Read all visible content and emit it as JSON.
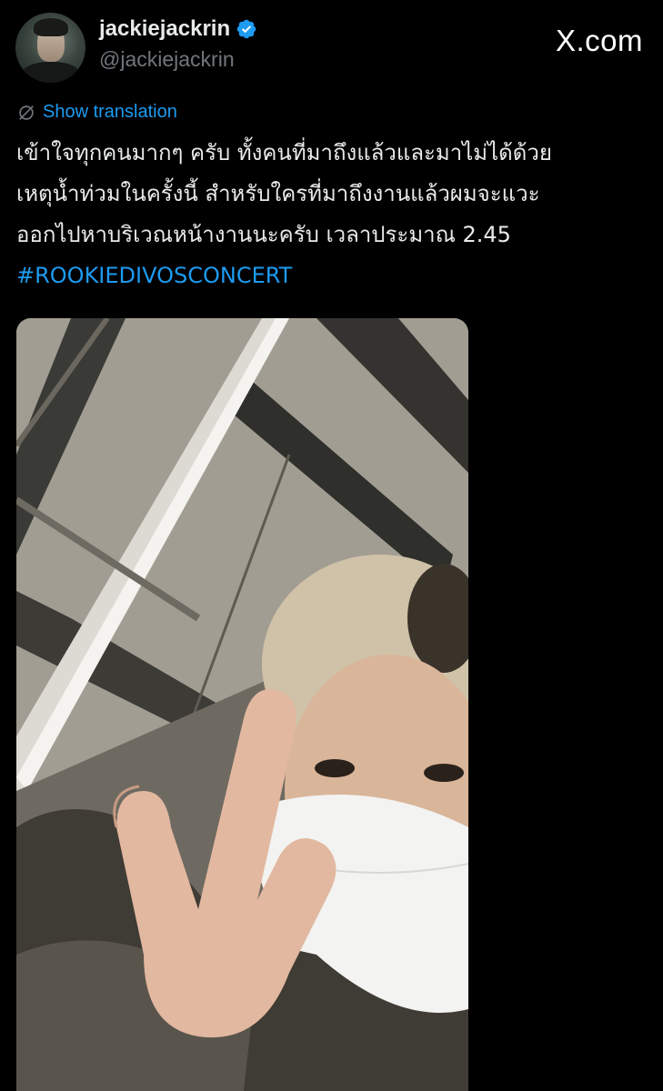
{
  "tweet": {
    "author": {
      "display_name": "jackiejackrin",
      "handle": "@jackiejackrin",
      "verified": true,
      "avatar_icon": "profile-photo"
    },
    "brand": "X.com",
    "show_translation_label": "Show translation",
    "text_lines": [
      "เข้าใจทุกคนมากๆ ครับ ทั้งคนที่มาถึงแล้วและมาไม่ได้ด้วย",
      "เหตุน้ำท่วมในครั้งนี้ สำหรับใครที่มาถึงงานแล้วผมจะแวะ",
      "ออกไปหาบริเวณหน้างานนะครับ เวลาประมาณ 2.45"
    ],
    "hashtag": "#ROOKIEDIVOSCONCERT",
    "media": {
      "type": "photo",
      "subject": "selfie with peace sign and white face mask"
    }
  },
  "colors": {
    "background": "#000000",
    "text": "#e7e9ea",
    "secondary_text": "#71767b",
    "link": "#1d9bf0",
    "verified_badge": "#1d9bf0"
  }
}
